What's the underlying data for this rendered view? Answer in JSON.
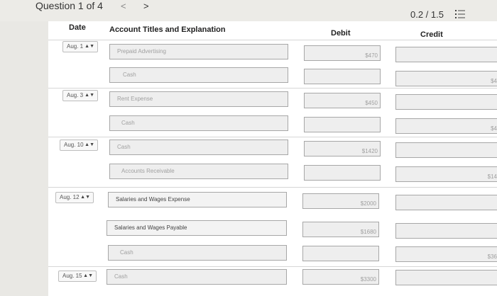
{
  "header": {
    "question": "Question 1 of 4",
    "prev_glyph": "<",
    "next_glyph": ">",
    "score": "0.2 / 1.5"
  },
  "table": {
    "columns": [
      "Date",
      "Account Titles and Explanation",
      "Debit",
      "Credit"
    ],
    "rows": [
      {
        "date": "Aug. 1",
        "account": "Prepaid Advertising",
        "debit": "$470",
        "credit": ""
      },
      {
        "date": "",
        "account": "Cash",
        "debit": "",
        "credit": "$4"
      },
      {
        "date": "Aug. 3",
        "account": "Rent Expense",
        "debit": "$450",
        "credit": ""
      },
      {
        "date": "",
        "account": "Cash",
        "debit": "",
        "credit": "$4"
      },
      {
        "date": "Aug. 10",
        "account": "Cash",
        "debit": "$1420",
        "credit": ""
      },
      {
        "date": "",
        "account": "Accounts Receivable",
        "debit": "",
        "credit": "$14"
      },
      {
        "date": "Aug. 12",
        "account": "Salaries and Wages Expense",
        "debit": "$2000",
        "credit": ""
      },
      {
        "date": "",
        "account": "Salaries and Wages Payable",
        "debit": "$1680",
        "credit": ""
      },
      {
        "date": "",
        "account": "Cash",
        "debit": "",
        "credit": "$36"
      },
      {
        "date": "Aug. 15",
        "account": "Cash",
        "debit": "$3300",
        "credit": ""
      }
    ]
  }
}
